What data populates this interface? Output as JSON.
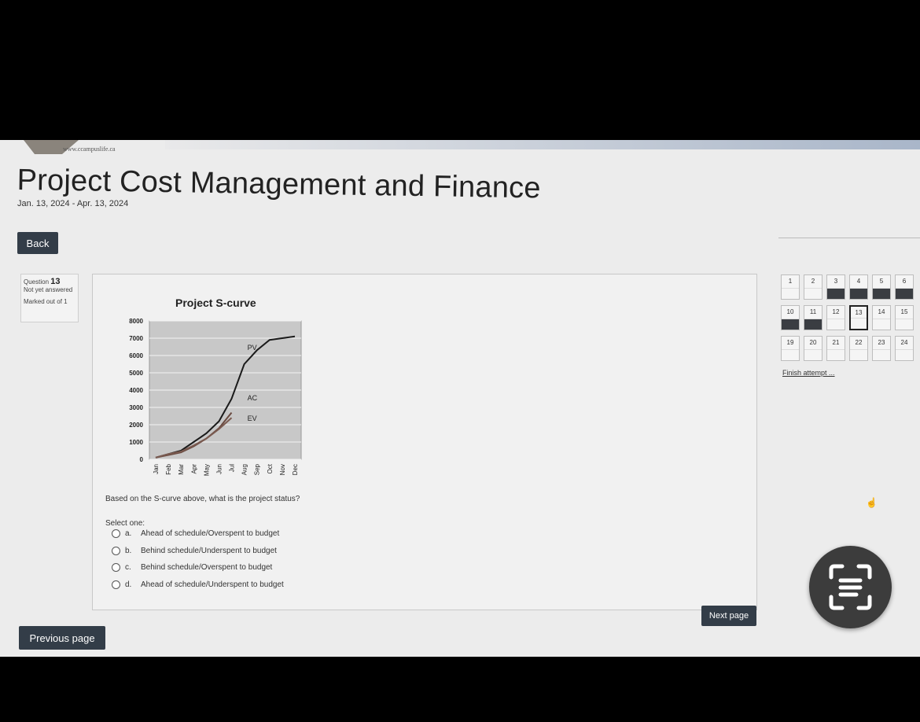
{
  "site_url": "www.ccampuslife.ca",
  "course": {
    "title": "Project Cost Management and Finance",
    "dates": "Jan. 13, 2024 - Apr. 13, 2024"
  },
  "back_label": "Back",
  "question_info": {
    "label": "Question",
    "number": "13",
    "status": "Not yet answered",
    "marks": "Marked out of 1"
  },
  "question": {
    "text": "Based on the S-curve above, what is the project status?",
    "select_one": "Select one:",
    "options": [
      {
        "letter": "a.",
        "text": "Ahead of schedule/Overspent to budget"
      },
      {
        "letter": "b.",
        "text": "Behind schedule/Underspent to budget"
      },
      {
        "letter": "c.",
        "text": "Behind schedule/Overspent to budget"
      },
      {
        "letter": "d.",
        "text": "Ahead of schedule/Underspent to budget"
      }
    ]
  },
  "navigation": {
    "cells": [
      {
        "n": "1",
        "answered": false,
        "current": false
      },
      {
        "n": "2",
        "answered": false,
        "current": false
      },
      {
        "n": "3",
        "answered": true,
        "current": false
      },
      {
        "n": "4",
        "answered": true,
        "current": false
      },
      {
        "n": "5",
        "answered": true,
        "current": false
      },
      {
        "n": "6",
        "answered": true,
        "current": false
      },
      {
        "n": "10",
        "answered": true,
        "current": false
      },
      {
        "n": "11",
        "answered": true,
        "current": false
      },
      {
        "n": "12",
        "answered": false,
        "current": false
      },
      {
        "n": "13",
        "answered": false,
        "current": true
      },
      {
        "n": "14",
        "answered": false,
        "current": false
      },
      {
        "n": "15",
        "answered": false,
        "current": false
      },
      {
        "n": "19",
        "answered": false,
        "current": false
      },
      {
        "n": "20",
        "answered": false,
        "current": false
      },
      {
        "n": "21",
        "answered": false,
        "current": false
      },
      {
        "n": "22",
        "answered": false,
        "current": false
      },
      {
        "n": "23",
        "answered": false,
        "current": false
      },
      {
        "n": "24",
        "answered": false,
        "current": false
      }
    ],
    "finish_label": "Finish attempt ..."
  },
  "previous_label": "Previous page",
  "next_label": "Next page",
  "chart_data": {
    "type": "line",
    "title": "Project S-curve",
    "categories": [
      "Jan",
      "Feb",
      "Mar",
      "Apr",
      "May",
      "Jun",
      "Jul",
      "Aug",
      "Sep",
      "Oct",
      "Nov",
      "Dec"
    ],
    "ylim": [
      0,
      8000
    ],
    "yticks": [
      0,
      1000,
      2000,
      3000,
      4000,
      5000,
      6000,
      7000,
      8000
    ],
    "grid": true,
    "series": [
      {
        "name": "PV",
        "color": "#1a1a1a",
        "values": [
          100,
          300,
          500,
          1000,
          1500,
          2200,
          3500,
          5500,
          6300,
          6900,
          7000,
          7100
        ]
      },
      {
        "name": "AC",
        "color": "#6a4a40",
        "values": [
          100,
          250,
          400,
          750,
          1200,
          1800,
          2700,
          null,
          null,
          null,
          null,
          null
        ]
      },
      {
        "name": "EV",
        "color": "#7a5a50",
        "values": [
          100,
          300,
          450,
          800,
          1200,
          1750,
          2400,
          null,
          null,
          null,
          null,
          null
        ]
      }
    ],
    "annotations": [
      {
        "text": "PV",
        "x": "Aug",
        "y": 6500
      },
      {
        "text": "AC",
        "x": "Aug",
        "y": 3600
      },
      {
        "text": "EV",
        "x": "Aug",
        "y": 2400
      }
    ]
  }
}
